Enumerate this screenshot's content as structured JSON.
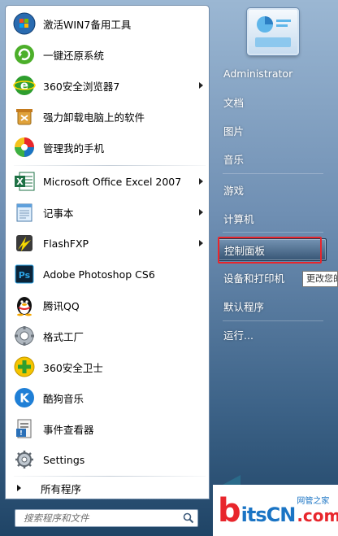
{
  "programs": [
    {
      "label": "激活WIN7备用工具",
      "icon": "win7-orb-icon",
      "arrow": false
    },
    {
      "label": "一键还原系统",
      "icon": "green-restore-icon",
      "arrow": false
    },
    {
      "label": "360安全浏览器7",
      "icon": "360-browser-icon",
      "arrow": true
    },
    {
      "label": "强力卸载电脑上的软件",
      "icon": "uninstall-bin-icon",
      "arrow": false
    },
    {
      "label": "管理我的手机",
      "icon": "phone-manager-icon",
      "arrow": false
    },
    {
      "label": "Microsoft Office Excel 2007",
      "icon": "excel-icon",
      "arrow": true
    },
    {
      "label": "记事本",
      "icon": "notepad-icon",
      "arrow": true
    },
    {
      "label": "FlashFXP",
      "icon": "flashfxp-icon",
      "arrow": true
    },
    {
      "label": "Adobe Photoshop CS6",
      "icon": "photoshop-icon",
      "arrow": false
    },
    {
      "label": "腾讯QQ",
      "icon": "qq-penguin-icon",
      "arrow": false
    },
    {
      "label": "格式工厂",
      "icon": "format-factory-icon",
      "arrow": false
    },
    {
      "label": "360安全卫士",
      "icon": "360-safe-icon",
      "arrow": false
    },
    {
      "label": "酷狗音乐",
      "icon": "kugou-icon",
      "arrow": false
    },
    {
      "label": "事件查看器",
      "icon": "event-viewer-icon",
      "arrow": false
    },
    {
      "label": "Settings",
      "icon": "settings-icon",
      "arrow": false
    }
  ],
  "all_programs_label": "所有程序",
  "search": {
    "placeholder": "搜索程序和文件"
  },
  "right_items": [
    {
      "label": "Administrator"
    },
    {
      "label": "文档"
    },
    {
      "label": "图片"
    },
    {
      "label": "音乐"
    },
    {
      "label": "游戏"
    },
    {
      "label": "计算机"
    },
    {
      "label": "控制面板"
    },
    {
      "label": "设备和打印机"
    },
    {
      "label": "默认程序"
    },
    {
      "label": "运行..."
    }
  ],
  "highlighted_item": "控制面板",
  "tooltip": "更改您的",
  "watermark": {
    "b": "b",
    "rest": "itsCN",
    "top": "网管之家",
    "com": ".com"
  },
  "colors": {
    "highlight_border": "#e8262c",
    "watermark_blue": "#1a74c4"
  }
}
